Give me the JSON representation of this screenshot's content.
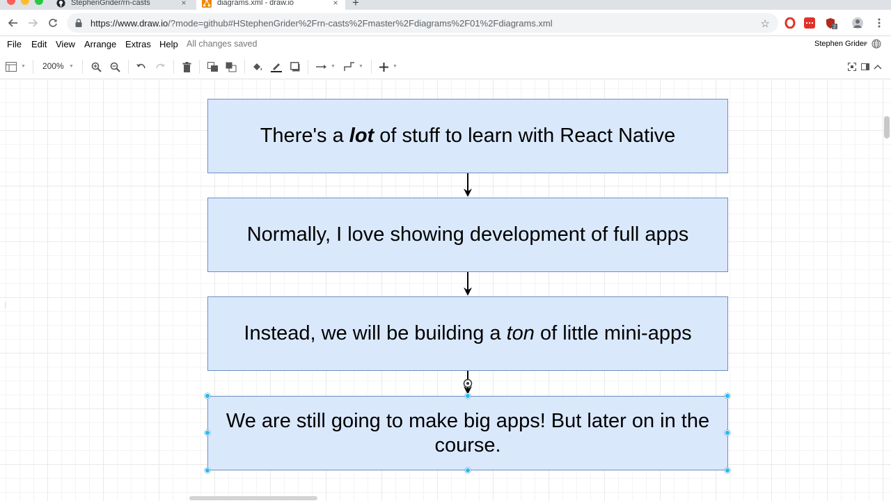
{
  "browser": {
    "tabs": [
      {
        "title": "StephenGrider/rn-casts",
        "close": "×",
        "icon": "github-icon"
      },
      {
        "title": "diagrams.xml - draw.io",
        "close": "×",
        "icon": "drawio-icon"
      }
    ],
    "new_tab": "+",
    "url_host": "https://www.draw.io",
    "url_rest": "/?mode=github#HStephenGrider%2Frn-casts%2Fmaster%2Fdiagrams%2F01%2Fdiagrams.xml"
  },
  "menubar": {
    "items": [
      "File",
      "Edit",
      "View",
      "Arrange",
      "Extras",
      "Help"
    ],
    "status": "All changes saved",
    "user": "Stephen Grider"
  },
  "toolbar": {
    "zoom": "200%"
  },
  "diagram": {
    "boxes": [
      {
        "before": "There's a ",
        "emph": "lot",
        "after": " of stuff to learn with React Native"
      },
      {
        "text": "Normally, I love showing development of full apps"
      },
      {
        "before": "Instead, we will be building a ",
        "emph": "ton",
        "after": " of little mini-apps"
      },
      {
        "text": "We are still going to make big apps!  But later on in the course."
      }
    ]
  },
  "colors": {
    "box_fill": "#dae8fc",
    "box_stroke": "#6c8ebf",
    "selection_handle": "#29b6f2"
  }
}
